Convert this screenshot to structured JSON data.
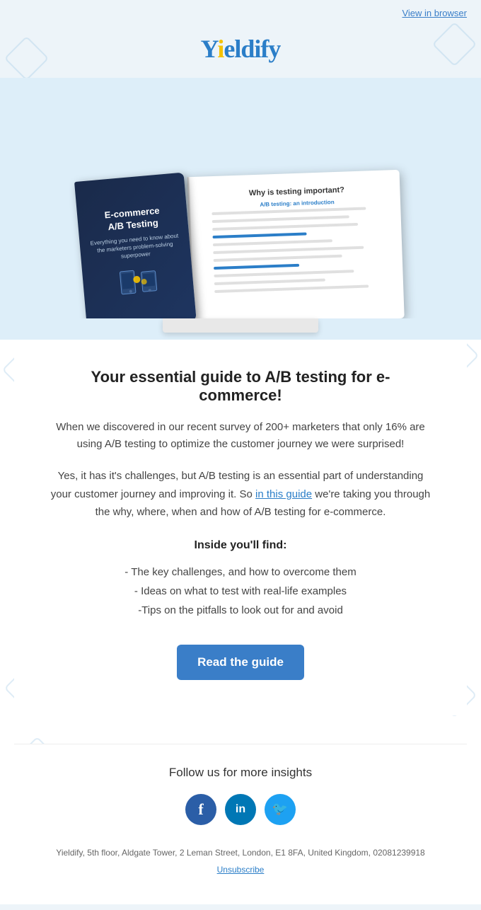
{
  "header": {
    "view_in_browser": "View in browser",
    "logo": "Yieldify"
  },
  "hero": {
    "book_title": "E-commerce\nA/B Testing",
    "book_subtitle": "Everything you need to know about the marketers problem-solving superpower",
    "open_book_heading": "Why is testing important?",
    "open_book_section": "A/B testing: an introduction"
  },
  "content": {
    "main_heading": "Your essential guide to A/B testing for e-commerce!",
    "intro_paragraph": "When we discovered in our recent survey of 200+ marketers that only 16% are using A/B testing to optimize the customer journey we were surprised!",
    "body_paragraph_before_link": "Yes, it has it's challenges, but A/B testing is an essential part of understanding your customer journey and improving it. So ",
    "link_text": "in this guide",
    "body_paragraph_after_link": " we're taking you through the why, where, when and how of A/B testing for e-commerce.",
    "inside_heading": "Inside you'll find:",
    "bullets": [
      "- The key challenges, and how to overcome them",
      "- Ideas on what to test with real-life examples",
      "-Tips on the pitfalls to look out for and avoid"
    ],
    "cta_button": "Read the guide"
  },
  "footer": {
    "follow_heading": "Follow us for more insights",
    "social": [
      {
        "name": "Facebook",
        "icon": "f",
        "type": "facebook"
      },
      {
        "name": "LinkedIn",
        "icon": "in",
        "type": "linkedin"
      },
      {
        "name": "Twitter",
        "icon": "🐦",
        "type": "twitter"
      }
    ],
    "address": "Yieldify, 5th floor, Aldgate Tower, 2 Leman Street, London, E1 8FA, United Kingdom, 02081239918",
    "unsubscribe": "Unsubscribe"
  }
}
